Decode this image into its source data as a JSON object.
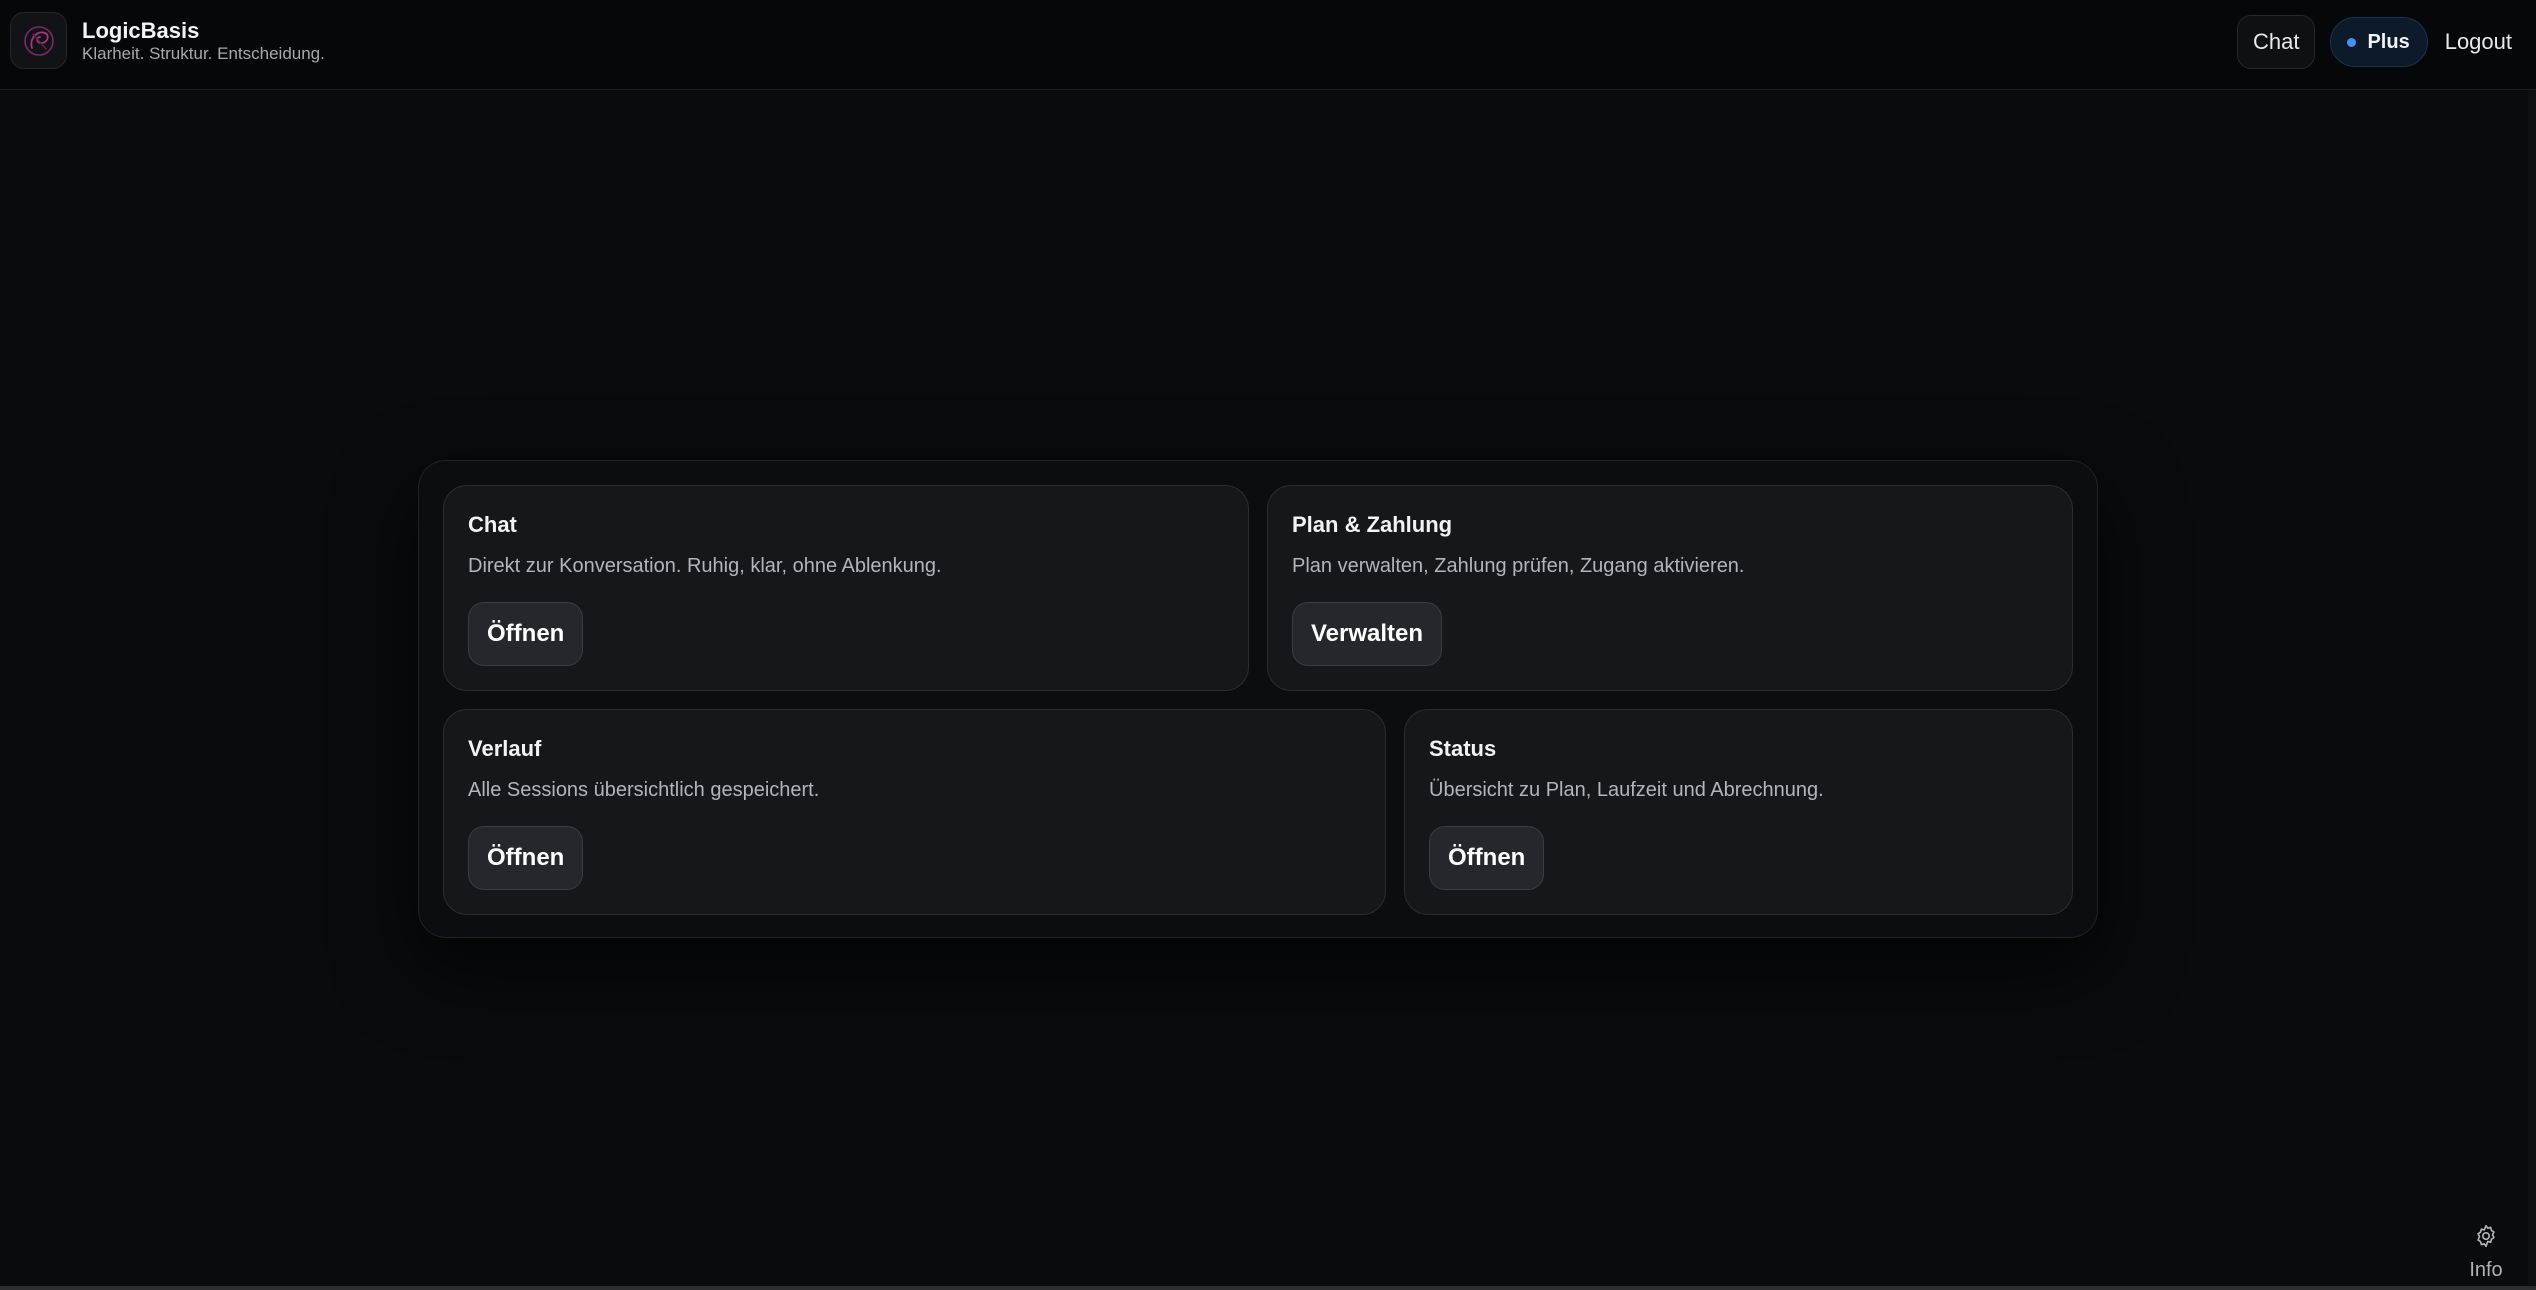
{
  "header": {
    "brand_name": "LogicBasis",
    "tagline": "Klarheit. Struktur. Entscheidung.",
    "nav_chat": "Chat",
    "plan_badge": "Plus",
    "logout": "Logout",
    "logo_icon": "swirl-logo-icon"
  },
  "cards": {
    "chat": {
      "title": "Chat",
      "description": "Direkt zur Konversation. Ruhig, klar, ohne Ablenkung.",
      "button": "Öffnen"
    },
    "plan": {
      "title": "Plan & Zahlung",
      "description": "Plan verwalten, Zahlung prüfen, Zugang aktivieren.",
      "button": "Verwalten"
    },
    "history": {
      "title": "Verlauf",
      "description": "Alle Sessions übersichtlich gespeichert.",
      "button": "Öffnen"
    },
    "status": {
      "title": "Status",
      "description": "Übersicht zu Plan, Laufzeit und Abrechnung.",
      "button": "Öffnen"
    }
  },
  "footer": {
    "info_label": "Info",
    "info_icon": "gear-icon"
  },
  "colors": {
    "background": "#0a0b0d",
    "card": "#16171b",
    "accent": "#4a8ff0",
    "logo_accent": "#8e2a6e"
  }
}
